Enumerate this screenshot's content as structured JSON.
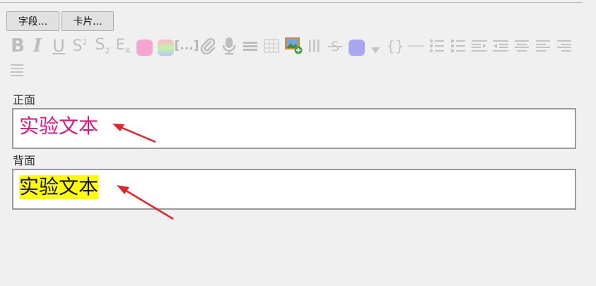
{
  "buttons": {
    "fields": "字段...",
    "cards": "卡片..."
  },
  "toolbar": {
    "bold": "B",
    "italic": "I",
    "underline": "U",
    "superscript_base": "S",
    "superscript_mark": "2",
    "subscript_base": "S",
    "subscript_mark": "2",
    "clear_base": "E",
    "clear_mark": "x",
    "cloze": "[...]",
    "code": "{}",
    "icons": [
      "bold-icon",
      "italic-icon",
      "underline-icon",
      "superscript-icon",
      "subscript-icon",
      "clear-formatting-icon",
      "text-color-icon",
      "highlight-color-icon",
      "cloze-icon",
      "attachment-icon",
      "record-audio-icon",
      "horizontal-rule-icon",
      "table-icon",
      "insert-image-icon",
      "columns-icon",
      "strikethrough-icon",
      "color-picker-icon",
      "dropdown-arrow-icon",
      "code-icon",
      "line-icon",
      "bullet-list-icon",
      "numbered-list-icon",
      "indent-icon",
      "outdent-icon",
      "align-center-icon",
      "align-left-icon",
      "align-right-icon",
      "justify-icon"
    ],
    "colors": {
      "text_color": "#f4a6d0",
      "highlight_top": "#f9b8c8",
      "highlight_mid": "#c8f0a8",
      "highlight_bot": "#b8c8f8",
      "color_picker": "#a8a8f0"
    }
  },
  "fields": {
    "front": {
      "label": "正面",
      "text": "实验文本",
      "color": "#e0157c"
    },
    "back": {
      "label": "背面",
      "text": "实验文本",
      "highlight": "#ffff00"
    }
  },
  "annotation_arrow_color": "#e3242b"
}
